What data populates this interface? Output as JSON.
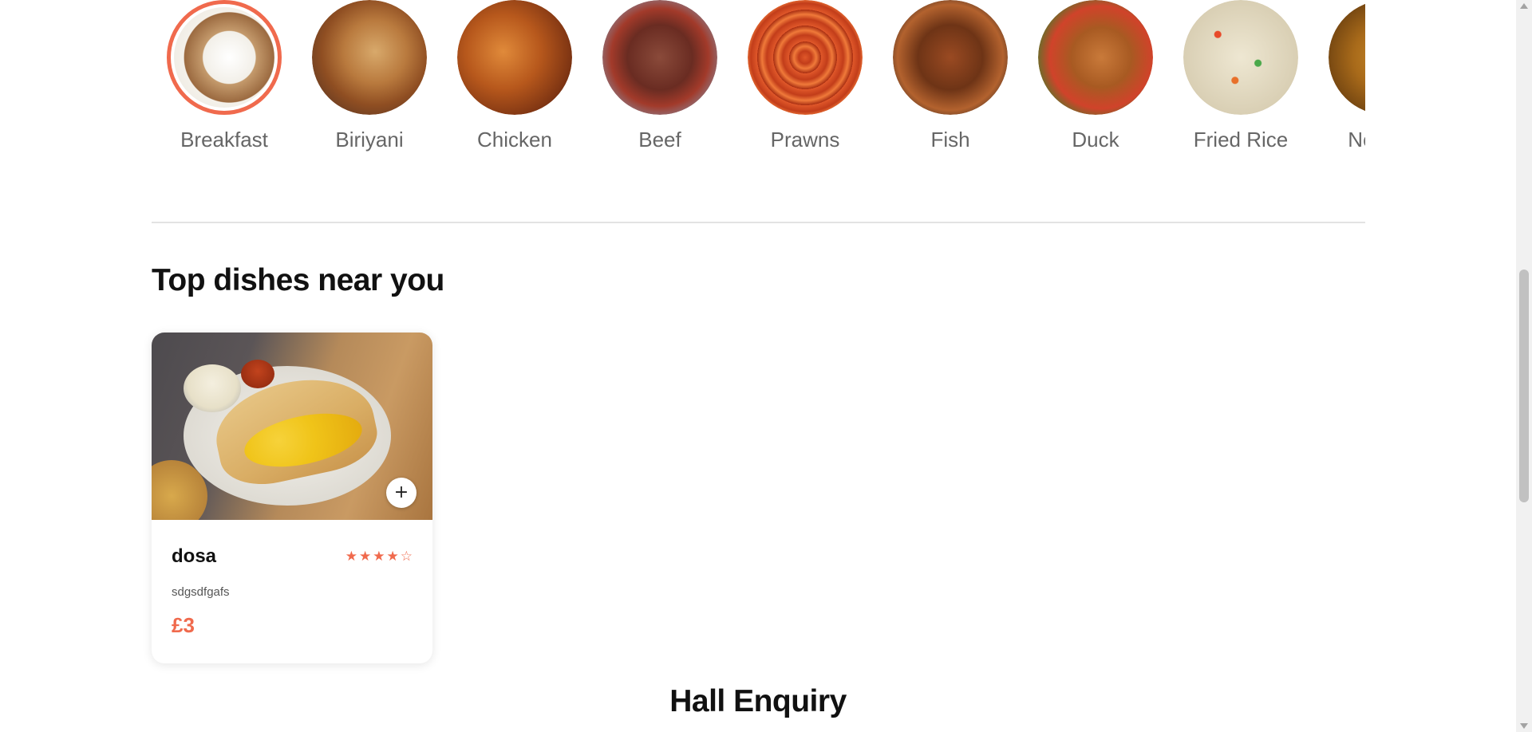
{
  "categories": [
    {
      "label": "Breakfast",
      "icon": "dosa-image",
      "active": true,
      "color": "#b98a5e"
    },
    {
      "label": "Biriyani",
      "icon": "biriyani-image",
      "active": false,
      "color": "#9b5a2e"
    },
    {
      "label": "Chicken",
      "icon": "chicken-image",
      "active": false,
      "color": "#a4521f"
    },
    {
      "label": "Beef",
      "icon": "beef-image",
      "active": false,
      "color": "#7c3a2a"
    },
    {
      "label": "Prawns",
      "icon": "prawns-image",
      "active": false,
      "color": "#c4461f"
    },
    {
      "label": "Fish",
      "icon": "fish-image",
      "active": false,
      "color": "#6a3a20"
    },
    {
      "label": "Duck",
      "icon": "duck-image",
      "active": false,
      "color": "#b85a25"
    },
    {
      "label": "Fried Rice",
      "icon": "fried-rice-image",
      "active": false,
      "color": "#d9d2b8"
    },
    {
      "label": "Noodles",
      "icon": "noodles-image",
      "active": false,
      "color": "#b07a2a"
    }
  ],
  "top_dishes": {
    "title": "Top dishes near you",
    "items": [
      {
        "name": "dosa",
        "description": "sdgsdfgafs",
        "price": "£3",
        "rating": 4,
        "rating_max": 5,
        "add_label": "+"
      }
    ]
  },
  "hall": {
    "title": "Hall Enquiry"
  },
  "colors": {
    "accent": "#f06a4d",
    "divider": "#e3e3e3"
  }
}
